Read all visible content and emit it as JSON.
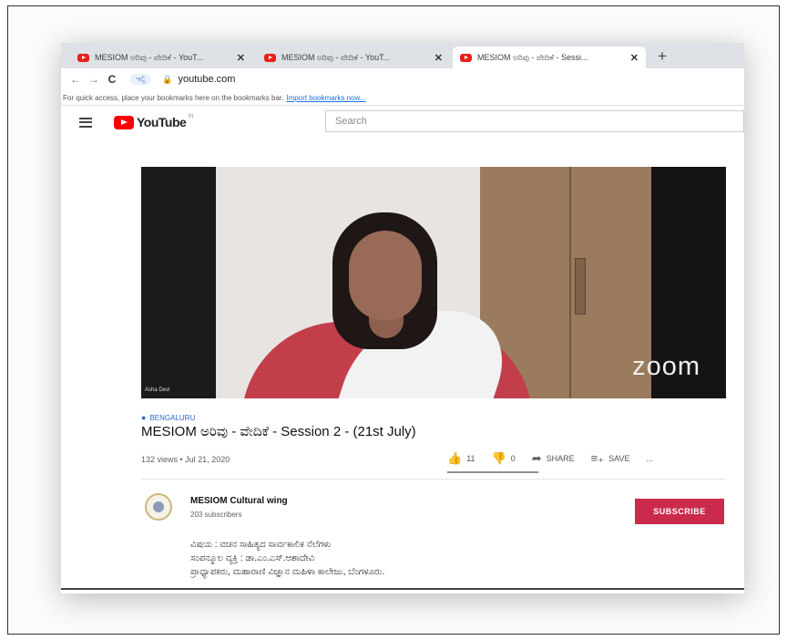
{
  "browser": {
    "tabs": [
      {
        "title": "MESIOM ಅರಿವು - ವೇದಿಕೆ - YouT...",
        "close": "✕",
        "active": false
      },
      {
        "title": "MESIOM ಅರಿವು - ವೇದಿಕೆ - YouT...",
        "close": "✕",
        "active": false
      },
      {
        "title": "MESIOM ಅರಿವು - ವೇದಿಕೆ - Sessi...",
        "close": "✕",
        "active": true
      }
    ],
    "new_tab": "+",
    "back": "←",
    "forward": "→",
    "reload": "C",
    "pill": "ಇಲ್ಲಿ",
    "url": "youtube.com",
    "bookmarks_msg": "For quick access, place your bookmarks here on the bookmarks bar.",
    "bookmarks_link": "Import bookmarks now..."
  },
  "youtube": {
    "logo_text": "YouTube",
    "logo_sup": "IN",
    "search_placeholder": "Search"
  },
  "video": {
    "watermark": "zoom",
    "speaker_label": "Asha Devi",
    "location": "BENGALURU",
    "title": "MESIOM ಅರಿವು - ವೇದಿಕೆ - Session 2 - (21st July)",
    "stats": "132 views • Jul 21, 2020",
    "likes": "11",
    "dislikes": "0",
    "share_label": "SHARE",
    "save_label": "SAVE",
    "more_label": "..."
  },
  "channel": {
    "name": "MESIOM Cultural wing",
    "subscribers": "203 subscribers",
    "subscribe_label": "SUBSCRIBE",
    "description": [
      "ವಿಷಯ : ವಚನ ಸಾಹಿತ್ಯದ ಸಾರ್ವಕಾಲಿಕ ನೆಲೆಗಳು",
      "ಸಂಪನ್ಮೂಲ ವ್ಯಕ್ತಿ : ಡಾ.ಎಂ.ಎಸ್.ಆಶಾದೇವಿ",
      "ಪ್ರಾಧ್ಯಾಪಕರು, ಮಹಾರಾಣಿ ವಿಜ್ಞಾನ ಮಹಿಳಾ ಕಾಲೇಜು, ಬೆಂಗಳೂರು."
    ]
  },
  "colors": {
    "subscribe": "#cc2a4c",
    "youtube_red": "#ff0000",
    "link": "#1a73e8"
  }
}
